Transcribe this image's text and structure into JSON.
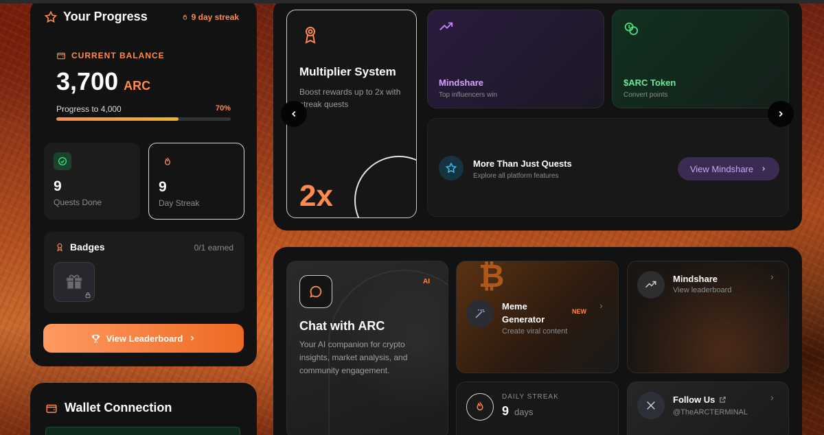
{
  "progress": {
    "title": "Your Progress",
    "streak_badge": "9 day streak",
    "balance_label": "CURRENT BALANCE",
    "balance_value": "3,700",
    "balance_unit": "ARC",
    "progress_label": "Progress to 4,000",
    "progress_pct": "70%",
    "progress_fraction": 0.7,
    "quests_value": "9",
    "quests_label": "Quests Done",
    "streak_value": "9",
    "streak_label": "Day Streak",
    "badges_title": "Badges",
    "badges_earned": "0/1 earned",
    "leaderboard_button": "View Leaderboard"
  },
  "wallet": {
    "title": "Wallet Connection"
  },
  "features": {
    "multiplier": {
      "title": "Multiplier System",
      "desc": "Boost rewards up to 2x with streak quests",
      "big": "2x"
    },
    "mindshare": {
      "title": "Mindshare",
      "desc": "Top influencers win"
    },
    "token": {
      "title": "$ARC Token",
      "desc": "Convert points"
    },
    "more": {
      "title": "More Than Just Quests",
      "desc": "Explore all platform features",
      "button": "View Mindshare"
    }
  },
  "tools": {
    "chat": {
      "title": "Chat with ARC",
      "tag": "AI",
      "desc": "Your AI companion for crypto insights, market analysis, and community engagement."
    },
    "meme": {
      "title": "Meme Generator",
      "tag": "NEW",
      "desc": "Create viral content"
    },
    "leaderboard": {
      "title": "Mindshare",
      "desc": "View leaderboard"
    },
    "daily": {
      "label": "DAILY STREAK",
      "value": "9",
      "unit": "days"
    },
    "follow": {
      "title": "Follow Us",
      "handle": "@TheARCTERMINAL"
    }
  },
  "colors": {
    "accent": "#ff8a4c",
    "purple": "#c084fc",
    "green": "#4ade80",
    "cyan": "#38bdf8"
  }
}
